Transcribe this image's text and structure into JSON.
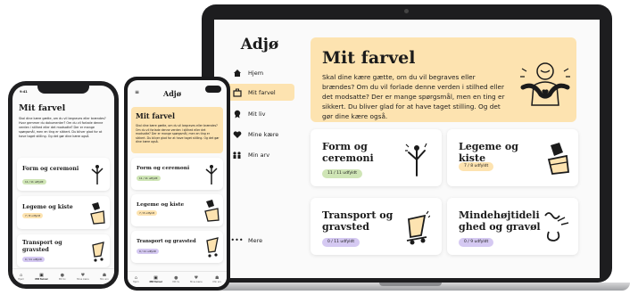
{
  "app": {
    "logo": "Adjø"
  },
  "sidebar": {
    "items": [
      {
        "label": "Hjem",
        "icon": "house-icon"
      },
      {
        "label": "Mit farvel",
        "icon": "suitcase-icon",
        "active": true
      },
      {
        "label": "Mit liv",
        "icon": "badge-icon"
      },
      {
        "label": "Mine kære",
        "icon": "heart-icon"
      },
      {
        "label": "Min arv",
        "icon": "family-icon"
      }
    ],
    "more": "Mere"
  },
  "hero": {
    "title": "Mit farvel",
    "text": "Skal dine kære gætte, om du vil begraves eller brændes? Om du vil forlade denne verden i stilhed eller det modsatte? Der er mange spørgsmål, men en ting er sikkert. Du bliver glad for at have taget stilling. Og det gør dine kære også."
  },
  "cards": [
    {
      "title": "Form og ceremoni",
      "progress": "11 / 11 udfyldt",
      "badge_color": "green"
    },
    {
      "title": "Legeme og kiste",
      "progress": "7 / 8 udfyldt",
      "badge_color": "yellow"
    },
    {
      "title": "Transport og gravsted",
      "progress": "0 / 11 udfyldt",
      "badge_color": "purple"
    },
    {
      "title": "Mindehøjtidelighed og gravøl",
      "progress": "0 / 9 udfyldt",
      "badge_color": "purple"
    }
  ],
  "iphone": {
    "time": "9:41",
    "title": "Mit farvel",
    "text": "Skal dine kære gætte, om du vil begraves eller brændes? Hvor gemmer du dokumenter? Om du vil forlade denne verden i stilhed eller det modsatte? Der er mange spørgsmål, men en ting er sikkert. Du bliver glad for at have taget stilling. Og det gør dine kære også.",
    "cards": [
      {
        "title": "Form og ceremoni",
        "progress": "11 / 11 udfyldt",
        "badge_color": "green"
      },
      {
        "title": "Legeme og kiste",
        "progress": "7 / 8 udfyldt",
        "badge_color": "yellow"
      },
      {
        "title": "Transport og gravsted",
        "progress": "0 / 11 udfyldt",
        "badge_color": "purple"
      }
    ],
    "tabs": [
      "Hjem",
      "Mit farvel",
      "Mit liv",
      "Mine kære",
      "Min arv"
    ]
  },
  "android": {
    "logo": "Adjø",
    "title": "Mit farvel",
    "text": "Skal dine kære gætte, om du vil begraves eller brændes? Om du vil forlade denne verden i stilhed eller det modsatte? Der er mange spørgsmål, men en ting er sikkert. Du bliver glad for at have taget stilling. Og det gør dine kære også.",
    "cards": [
      {
        "title": "Form og ceremoni",
        "progress": "11 / 11 udfyldt",
        "badge_color": "green"
      },
      {
        "title": "Legeme og kiste",
        "progress": "7 / 8 udfyldt",
        "badge_color": "yellow"
      },
      {
        "title": "Transport og gravsted",
        "progress": "0 / 11 udfyldt",
        "badge_color": "purple"
      }
    ],
    "tabs": [
      "Hjem",
      "Mit farvel",
      "Mit liv",
      "Mine kære",
      "Min arv"
    ]
  },
  "colors": {
    "accent": "#fde3b0",
    "green": "#cfe5b6",
    "purple": "#d5c9f2",
    "text": "#1b1b1b"
  }
}
